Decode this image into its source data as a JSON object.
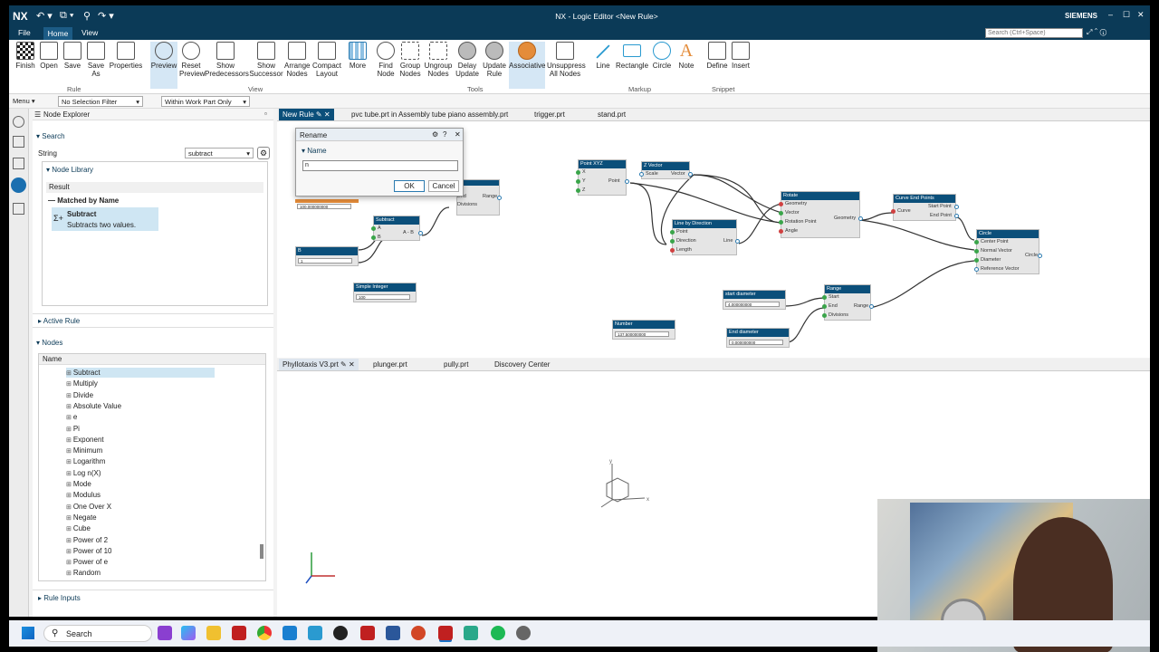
{
  "app": {
    "logo": "NX",
    "title": "NX - Logic Editor <New Rule>",
    "brand": "SIEMENS",
    "search_placeholder": "Search (Ctrl+Space)"
  },
  "menu": {
    "file": "File",
    "home": "Home",
    "view": "View"
  },
  "ribbon": {
    "rule": [
      {
        "line1": "Finish",
        "line2": ""
      },
      {
        "line1": "Open",
        "line2": ""
      },
      {
        "line1": "Save",
        "line2": ""
      },
      {
        "line1": "Save",
        "line2": "As"
      },
      {
        "line1": "Properties",
        "line2": ""
      }
    ],
    "view": [
      {
        "line1": "Preview",
        "line2": ""
      },
      {
        "line1": "Reset",
        "line2": "Preview"
      },
      {
        "line1": "Show",
        "line2": "Predecessors"
      },
      {
        "line1": "Show",
        "line2": "Successor"
      },
      {
        "line1": "Arrange",
        "line2": "Nodes"
      },
      {
        "line1": "Compact",
        "line2": "Layout"
      },
      {
        "line1": "More",
        "line2": ""
      }
    ],
    "tools": [
      {
        "line1": "Find",
        "line2": "Node"
      },
      {
        "line1": "Group",
        "line2": "Nodes"
      },
      {
        "line1": "Ungroup",
        "line2": "Nodes"
      },
      {
        "line1": "Delay",
        "line2": "Update"
      },
      {
        "line1": "Update",
        "line2": "Rule"
      },
      {
        "line1": "Associative",
        "line2": ""
      },
      {
        "line1": "Unsuppress",
        "line2": "All Nodes"
      }
    ],
    "markup": [
      {
        "line1": "Line",
        "line2": ""
      },
      {
        "line1": "Rectangle",
        "line2": ""
      },
      {
        "line1": "Circle",
        "line2": ""
      },
      {
        "line1": "Note",
        "line2": ""
      }
    ],
    "snippet": [
      {
        "line1": "Define",
        "line2": ""
      },
      {
        "line1": "Insert",
        "line2": ""
      }
    ],
    "groups": {
      "rule": "Rule",
      "view": "View",
      "tools": "Tools",
      "markup": "Markup",
      "snippet": "Snippet"
    }
  },
  "filterbar": {
    "menu": "Menu ▾",
    "selection_filter": "No Selection Filter",
    "scope": "Within Work Part Only"
  },
  "explorer": {
    "title": "Node Explorer",
    "search": "Search",
    "string_label": "String",
    "string_value": "subtract",
    "node_library": "Node Library",
    "result": "Result",
    "matched": "Matched by Name",
    "result_title": "Subtract",
    "result_desc": "Subtracts two values.",
    "active_rule": "Active Rule",
    "nodes": "Nodes",
    "name_col": "Name",
    "node_list": [
      "Subtract",
      "Multiply",
      "Divide",
      "Absolute Value",
      "e",
      "Pi",
      "Exponent",
      "Minimum",
      "Logarithm",
      "Log n(X)",
      "Mode",
      "Modulus",
      "One Over X",
      "Negate",
      "Cube",
      "Power of 2",
      "Power of 10",
      "Power of e",
      "Random",
      "Square Root"
    ],
    "rule_inputs": "Rule Inputs"
  },
  "graph_tabs": [
    "New Rule",
    "pvc tube.prt in Assembly tube piano assembly.prt",
    "trigger.prt",
    "stand.prt"
  ],
  "view_tabs": [
    "Phyllotaxis V3.prt",
    "plunger.prt",
    "pully.prt",
    "Discovery Center"
  ],
  "dialog": {
    "title": "Rename",
    "section": "Name",
    "value": "n",
    "ok": "OK",
    "cancel": "Cancel"
  },
  "nodes": {
    "subtract": {
      "title": "Subtract",
      "a": "A",
      "b": "B",
      "out": "A - B"
    },
    "b": {
      "title": "B",
      "value": "1"
    },
    "top_value": "100.000000000",
    "range1": {
      "end": "End",
      "divisions": "Divisions",
      "out": "Range"
    },
    "simple_integer": {
      "title": "Simple Integer",
      "value": "100"
    },
    "number": {
      "title": "Number",
      "value": "137.500000000"
    },
    "point_xyz": {
      "title": "Point XYZ",
      "x": "X",
      "y": "Y",
      "z": "Z",
      "out": "Point"
    },
    "z_vector": {
      "title": "Z Vector",
      "scale": "Scale",
      "out": "Vector"
    },
    "line_by_direction": {
      "title": "Line by Direction",
      "point": "Point",
      "direction": "Direction",
      "length": "Length",
      "out": "Line"
    },
    "rotate": {
      "title": "Rotate",
      "geometry": "Geometry",
      "vector": "Vector",
      "rotation_point": "Rotation Point",
      "angle": "Angle",
      "out": "Geometry"
    },
    "curve_end_points": {
      "title": "Curve End Points",
      "curve": "Curve",
      "start": "Start Point",
      "end": "End Point"
    },
    "circle": {
      "title": "Circle",
      "center": "Center Point",
      "normal": "Normal Vector",
      "diameter": "Diameter",
      "ref": "Reference Vector",
      "out": "Circle"
    },
    "start_diameter": {
      "title": "start diameter",
      "value": "4.000000000"
    },
    "end_diameter": {
      "title": "End diameter",
      "value": "0.000000000"
    },
    "range2": {
      "title": "Range",
      "start": "Start",
      "end": "End",
      "divisions": "Divisions",
      "out": "Range"
    }
  },
  "taskbar": {
    "search": "Search"
  },
  "colors": {
    "nx_blue": "#0b3a57",
    "node_header": "#0b4f7a",
    "accent": "#1a73c8"
  }
}
